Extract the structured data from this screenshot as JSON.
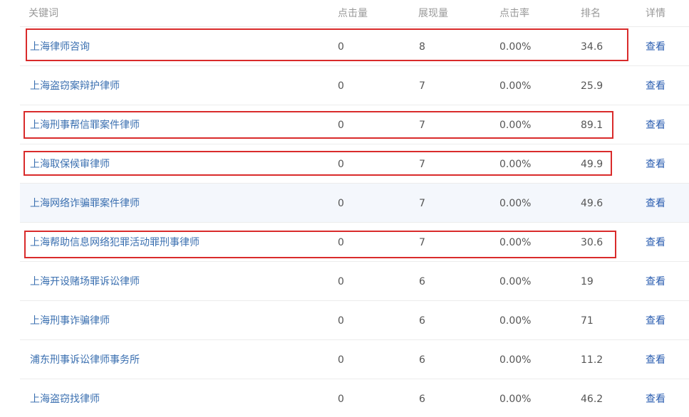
{
  "headers": {
    "keyword": "关键词",
    "clicks": "点击量",
    "impressions": "展现量",
    "ctr": "点击率",
    "rank": "排名",
    "detail": "详情"
  },
  "rows": [
    {
      "keyword": "上海律师咨询",
      "clicks": "0",
      "impressions": "8",
      "ctr": "0.00%",
      "rank": "34.6",
      "detail": "查看"
    },
    {
      "keyword": "上海盗窃案辩护律师",
      "clicks": "0",
      "impressions": "7",
      "ctr": "0.00%",
      "rank": "25.9",
      "detail": "查看"
    },
    {
      "keyword": "上海刑事帮信罪案件律师",
      "clicks": "0",
      "impressions": "7",
      "ctr": "0.00%",
      "rank": "89.1",
      "detail": "查看"
    },
    {
      "keyword": "上海取保候审律师",
      "clicks": "0",
      "impressions": "7",
      "ctr": "0.00%",
      "rank": "49.9",
      "detail": "查看"
    },
    {
      "keyword": "上海网络诈骗罪案件律师",
      "clicks": "0",
      "impressions": "7",
      "ctr": "0.00%",
      "rank": "49.6",
      "detail": "查看"
    },
    {
      "keyword": "上海帮助信息网络犯罪活动罪刑事律师",
      "clicks": "0",
      "impressions": "7",
      "ctr": "0.00%",
      "rank": "30.6",
      "detail": "查看"
    },
    {
      "keyword": "上海开设赌场罪诉讼律师",
      "clicks": "0",
      "impressions": "6",
      "ctr": "0.00%",
      "rank": "19",
      "detail": "查看"
    },
    {
      "keyword": "上海刑事诈骗律师",
      "clicks": "0",
      "impressions": "6",
      "ctr": "0.00%",
      "rank": "71",
      "detail": "查看"
    },
    {
      "keyword": "浦东刑事诉讼律师事务所",
      "clicks": "0",
      "impressions": "6",
      "ctr": "0.00%",
      "rank": "11.2",
      "detail": "查看"
    },
    {
      "keyword": "上海盗窃找律师",
      "clicks": "0",
      "impressions": "6",
      "ctr": "0.00%",
      "rank": "46.2",
      "detail": "查看"
    }
  ],
  "colors": {
    "link": "#3a6fb0",
    "annotation_box": "#d92b2b",
    "hover_row": "#f4f7fc"
  }
}
